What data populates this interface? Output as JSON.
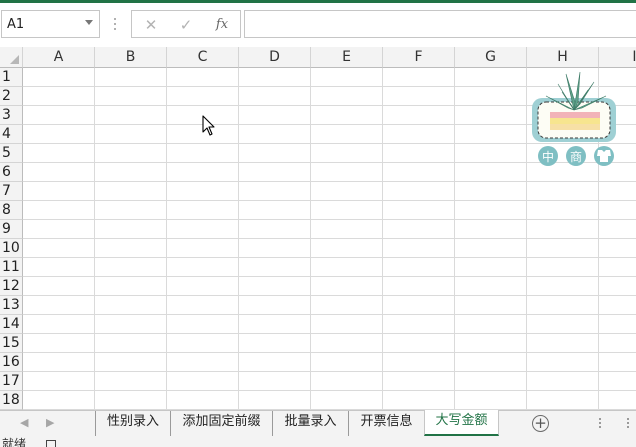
{
  "formula_bar": {
    "name_box_value": "A1",
    "cancel_glyph": "✕",
    "enter_glyph": "✓",
    "function_glyph": "fx",
    "formula_value": ""
  },
  "columns": [
    "A",
    "B",
    "C",
    "D",
    "E",
    "F",
    "G",
    "H",
    "I"
  ],
  "rows": [
    "1",
    "2",
    "3",
    "4",
    "5",
    "6",
    "7",
    "8",
    "9",
    "10",
    "11",
    "12",
    "13",
    "14",
    "15",
    "16",
    "17",
    "18"
  ],
  "decoration": {
    "icon": "succulent-plant-sticker",
    "labels": [
      "中",
      "商",
      ""
    ]
  },
  "sheet_tabs": {
    "prev_glyph": "◀",
    "next_glyph": "▶",
    "tabs": [
      "性别录入",
      "添加固定前缀",
      "批量录入",
      "开票信息",
      "大写金额"
    ],
    "active_tab": "大写金额",
    "add_glyph": "+"
  },
  "status_bar": {
    "status_text": "就绪"
  },
  "colors": {
    "accent": "#217346",
    "header_bg": "#f3f3f3",
    "gridline": "#dadada"
  }
}
